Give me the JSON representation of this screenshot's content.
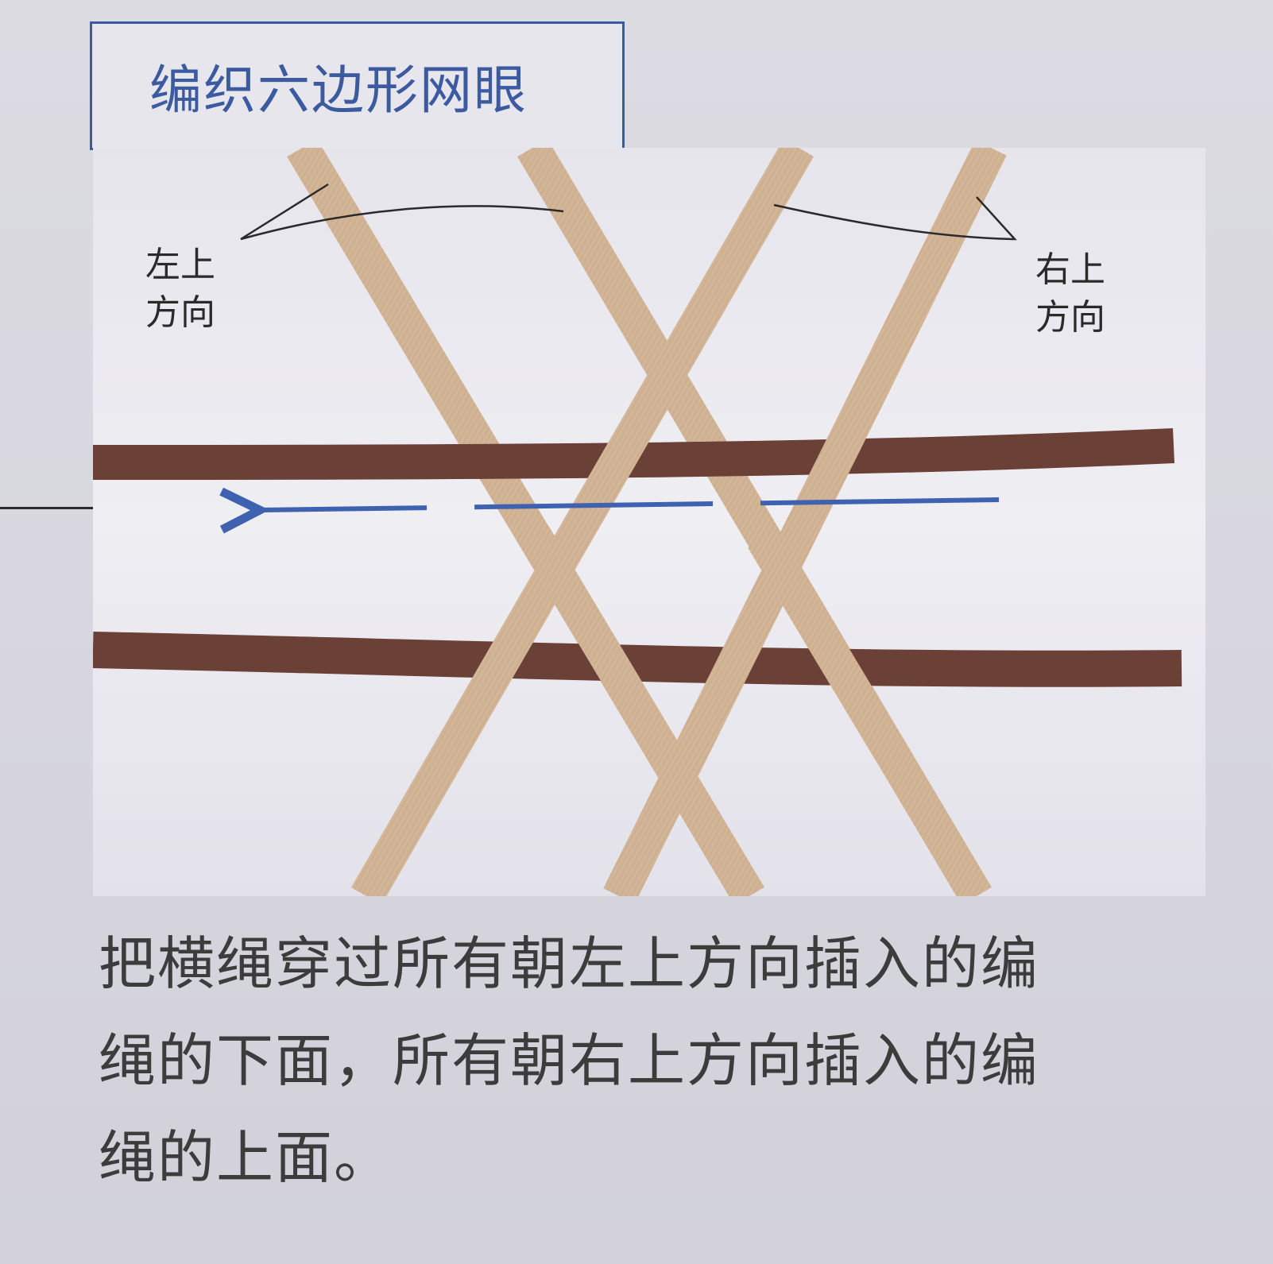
{
  "title": "编织六边形网眼",
  "labels": {
    "upper_left": [
      "左上",
      "方向"
    ],
    "upper_right": [
      "右上",
      "方向"
    ]
  },
  "caption": [
    "把横绳穿过所有朝左上方向插入的编",
    "绳的下面，所有朝右上方向插入的编",
    "绳的上面。"
  ],
  "colors": {
    "title_blue": "#3c5aa0",
    "arrow_blue": "#3e62b0",
    "horizontal_cord": "#6b4036",
    "diagonal_cord": "#d2b496",
    "photo_background": "#ecebf1",
    "page_background": "#d8d7df"
  },
  "photo": {
    "description_icons": [
      "direction-arrow-left-icon"
    ]
  }
}
